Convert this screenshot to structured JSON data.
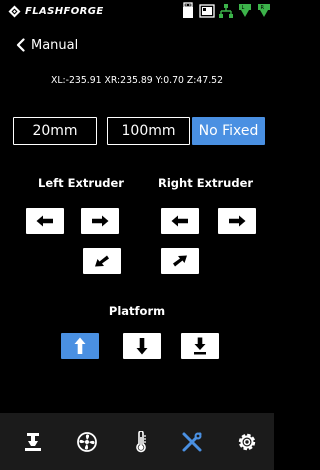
{
  "app": {
    "brand": "FLASHFORGE"
  },
  "status_icons": [
    "usb-icon",
    "camera-icon",
    "network-icon",
    "left-extruder-temp-icon",
    "right-extruder-temp-icon"
  ],
  "header": {
    "title": "Manual"
  },
  "position": {
    "text": "XL:-235.91  XR:235.89  Y:0.70  Z:47.52"
  },
  "steps": {
    "step_20": "20mm",
    "step_100": "100mm",
    "no_fixed": "No Fixed",
    "selected": "No Fixed"
  },
  "extruders": {
    "left_label": "Left Extruder",
    "right_label": "Right Extruder"
  },
  "platform": {
    "label": "Platform"
  },
  "tabs": [
    "home-icon",
    "fan-icon",
    "temperature-icon",
    "tools-icon",
    "settings-icon"
  ],
  "active_tab": "tools-icon",
  "colors": {
    "accent": "#4a90e2",
    "background": "#000000",
    "tabbar": "#1b1b1b",
    "status_green": "#3cb34a"
  }
}
